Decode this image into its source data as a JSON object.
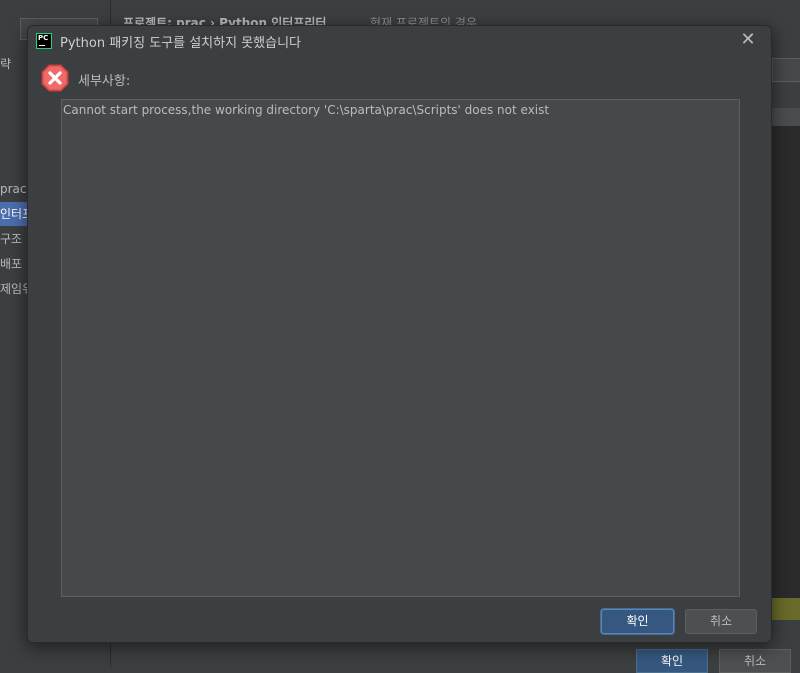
{
  "background_window": {
    "breadcrumb": "프로젝트: prac  ›  Python 인터프리터",
    "breadcrumb_note": "현재 프로젝트의 경우",
    "sidebar_items": [
      "략",
      "prac",
      "인터프",
      "구조",
      "배포",
      "제임워"
    ],
    "ok_label": "확인",
    "cancel_label": "취소"
  },
  "dialog": {
    "title": "Python 패키징 도구를 설치하지 못했습니다",
    "app_icon_text": "PC",
    "error_icon": "error-x-icon",
    "close_icon": "close-icon",
    "detail_label": "세부사항:",
    "message": "Cannot start process,the working directory 'C:\\sparta\\prac\\Scripts' does not exist",
    "ok_label": "확인",
    "cancel_label": "취소"
  },
  "colors": {
    "dialog_bg": "#3c3f41",
    "text_area_bg": "#45494a",
    "primary_button": "#365880",
    "selection": "#4b6eaf",
    "error_red": "#d64545"
  }
}
